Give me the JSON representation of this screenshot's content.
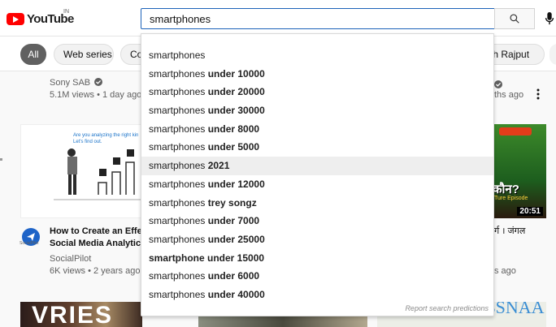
{
  "header": {
    "logo_text": "YouTube",
    "logo_region": "IN",
    "search_value": "smartphones",
    "search_icon": "search-icon",
    "mic_icon": "mic-icon"
  },
  "chips": [
    {
      "label": "All"
    },
    {
      "label": "Web series"
    },
    {
      "label": "Com"
    },
    {
      "label": "ngh Rajput"
    }
  ],
  "suggestions": {
    "items": [
      {
        "base": "smartphones",
        "rest": ""
      },
      {
        "base": "smartphones",
        "rest": " under 10000"
      },
      {
        "base": "smartphones",
        "rest": " under 20000"
      },
      {
        "base": "smartphones",
        "rest": " under 30000"
      },
      {
        "base": "smartphones",
        "rest": " under 8000"
      },
      {
        "base": "smartphones",
        "rest": " under 5000"
      },
      {
        "base": "smartphones",
        "rest": " 2021"
      },
      {
        "base": "smartphones",
        "rest": " under 12000"
      },
      {
        "base": "smartphones",
        "rest": " trey songz"
      },
      {
        "base": "smartphones",
        "rest": " under 7000"
      },
      {
        "base": "smartphones",
        "rest": " under 25000"
      },
      {
        "base": "",
        "rest": "smartphone under 15000"
      },
      {
        "base": "smartphones",
        "rest": " under 6000"
      },
      {
        "base": "smartphones",
        "rest": " under 40000"
      }
    ],
    "report_link": "Report search predictions"
  },
  "videos": {
    "row1_left": {
      "channel": "Sony SAB",
      "meta": "5.1M views • 1 day ago"
    },
    "row1_right": {
      "meta": "ths ago"
    },
    "row2_left": {
      "title_line1": "How to Create an Effec",
      "title_line2": "Social Media Analytics",
      "channel": "SocialPilot",
      "meta": "6K views • 2 years ago",
      "thumb_text1": "Are you analyzing the right kin",
      "thumb_text2": "Let's find out.",
      "avatar_caption": "SocialPilot"
    },
    "row2_right": {
      "title": "र्ग । जंगल",
      "meta": "s ago",
      "duration": "20:51",
      "thumb_text": "कौन?",
      "thumb_sub": "Ture Episode"
    },
    "row3_left_text": "VRIES",
    "row3_right_text": "Life at LBSNAA"
  }
}
